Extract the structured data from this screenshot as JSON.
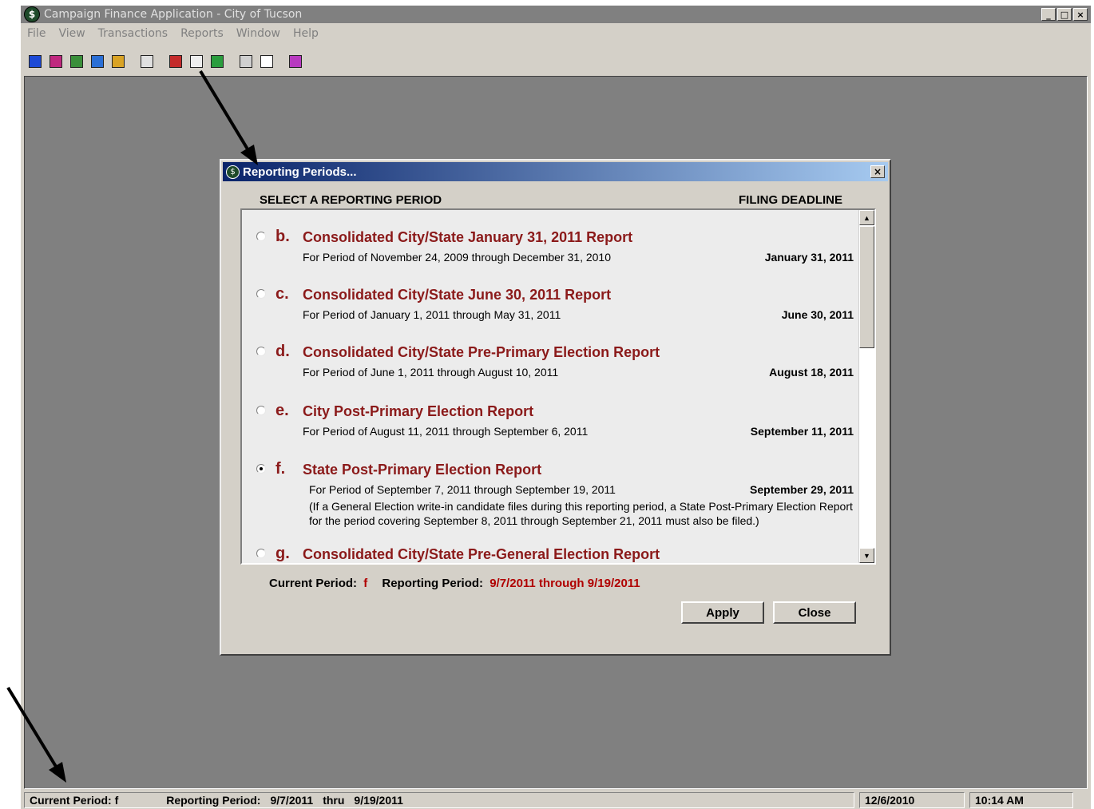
{
  "window": {
    "title": "Campaign Finance Application - City of Tucson",
    "controls": [
      "_",
      "□",
      "×"
    ]
  },
  "menu": [
    "File",
    "View",
    "Transactions",
    "Reports",
    "Window",
    "Help"
  ],
  "toolbar": {
    "icons": [
      "info-icon",
      "user-group-icon",
      "people-icon",
      "person-icon",
      "stack-icon",
      "preview-icon",
      "calendar-icon",
      "properties-icon",
      "globe-icon",
      "grid-icon",
      "window-icon",
      "eraser-icon"
    ],
    "colors": [
      "#1d4ad6",
      "#c0287f",
      "#3a8f3a",
      "#2a6fd6",
      "#d9a325",
      "#e0e0e0",
      "#c42b2b",
      "#eeeeee",
      "#2a9d3e",
      "#d0d0d0",
      "#ffffff",
      "#b83ac0"
    ]
  },
  "dialog": {
    "title": "Reporting Periods...",
    "close": "×",
    "header_left": "SELECT A REPORTING PERIOD",
    "header_right": "FILING DEADLINE",
    "items": [
      {
        "letter": "b.",
        "title": "Consolidated City/State January 31, 2011 Report",
        "period": "For Period of November 24, 2009  through  December 31, 2010",
        "deadline": "January 31, 2011",
        "selected": false
      },
      {
        "letter": "c.",
        "title": "Consolidated City/State June 30, 2011 Report",
        "period": "For Period of January 1, 2011 through May 31, 2011",
        "deadline": "June 30, 2011",
        "selected": false
      },
      {
        "letter": "d.",
        "title": "Consolidated City/State Pre-Primary Election Report",
        "period": "For Period of June 1, 2011 through August 10, 2011",
        "deadline": "August 18, 2011",
        "selected": false
      },
      {
        "letter": "e.",
        "title": "City Post-Primary Election Report",
        "period": "For Period of August 11, 2011 through September 6, 2011",
        "deadline": "September 11, 2011",
        "selected": false
      },
      {
        "letter": "f.",
        "title": "State Post-Primary Election Report",
        "period": "For Period of September 7, 2011 through September 19, 2011",
        "deadline": "September 29, 2011",
        "note": "(If a General Election write-in candidate files during this reporting period, a State Post-Primary Election Report for the period covering September 8, 2011 through September 21, 2011 must also be filed.)",
        "selected": true
      },
      {
        "letter": "g.",
        "title": "Consolidated City/State Pre-General Election Report",
        "period": "",
        "deadline": "",
        "selected": false
      }
    ],
    "current_label": "Current Period:",
    "current_value": "f",
    "reporting_label": "Reporting Period:",
    "reporting_value": "9/7/2011  through  9/19/2011",
    "apply": "Apply",
    "close_button": "Close"
  },
  "status": {
    "current_period": "Current Period: f",
    "reporting_label": "Reporting Period:",
    "from": "9/7/2011",
    "thru": "thru",
    "to": "9/19/2011",
    "date": "12/6/2010",
    "time": "10:14 AM"
  },
  "colors": {
    "accent": "#8b1a1a",
    "highlight": "#b00000",
    "titlebar_active": "#0a246a",
    "workspace": "#808080",
    "face": "#d4d0c8"
  }
}
